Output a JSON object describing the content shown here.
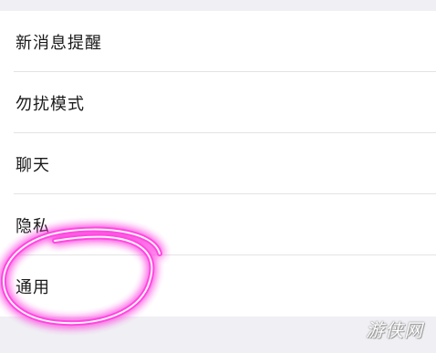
{
  "settings": {
    "items": [
      {
        "label": "新消息提醒"
      },
      {
        "label": "勿扰模式"
      },
      {
        "label": "聊天"
      },
      {
        "label": "隐私"
      },
      {
        "label": "通用"
      }
    ]
  },
  "annotation": {
    "highlight_color": "#ff3fe0",
    "highlighted_item": "通用"
  },
  "watermark": {
    "text": "游侠网"
  }
}
